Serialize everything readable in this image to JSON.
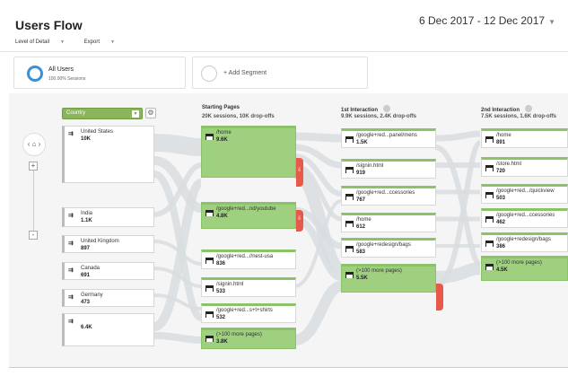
{
  "header": {
    "title": "Users Flow",
    "date_range": "6 Dec 2017 - 12 Dec 2017"
  },
  "toolbar": {
    "level_of_detail": "Level of Detail",
    "export": "Export"
  },
  "segments": {
    "all_users": {
      "title": "All Users",
      "subtitle": "100.00% Sessions"
    },
    "add_segment": "+ Add Segment"
  },
  "dimension_selector": {
    "value": "Country"
  },
  "countries": [
    {
      "name": "United States",
      "count": "10K"
    },
    {
      "name": "India",
      "count": "1.1K"
    },
    {
      "name": "United Kingdom",
      "count": "897"
    },
    {
      "name": "Canada",
      "count": "691"
    },
    {
      "name": "Germany",
      "count": "473"
    },
    {
      "name": "",
      "count": "6.4K"
    }
  ],
  "columns": [
    {
      "title": "Starting Pages",
      "subtitle": "20K sessions, 10K drop-offs",
      "pages": [
        {
          "name": "/home",
          "count": "9.6K"
        },
        {
          "name": "/google+red...nd/youtube",
          "count": "4.8K"
        },
        {
          "name": "/google+red...//nest-usa",
          "count": "836"
        },
        {
          "name": "/signin.html",
          "count": "533"
        },
        {
          "name": "/google+red...s+t+shirts",
          "count": "532"
        },
        {
          "name": "(>100 more pages)",
          "count": "3.8K"
        }
      ]
    },
    {
      "title": "1st Interaction",
      "subtitle": "9.9K sessions, 2.4K drop-offs",
      "pages": [
        {
          "name": "/google+red...panel/mens",
          "count": "1.5K"
        },
        {
          "name": "/signin.html",
          "count": "919"
        },
        {
          "name": "/google+red...ccessories",
          "count": "767"
        },
        {
          "name": "/home",
          "count": "612"
        },
        {
          "name": "/google+redesign/bags",
          "count": "583"
        },
        {
          "name": "(>100 more pages)",
          "count": "5.5K"
        }
      ]
    },
    {
      "title": "2nd Interaction",
      "subtitle": "7.5K sessions, 1.6K drop-offs",
      "pages": [
        {
          "name": "/home",
          "count": "891"
        },
        {
          "name": "/store.html",
          "count": "720"
        },
        {
          "name": "/google+red.../quickview",
          "count": "503"
        },
        {
          "name": "/google+red...ccessories",
          "count": "462"
        },
        {
          "name": "/google+redesign/bags",
          "count": "386"
        },
        {
          "name": "(>100 more pages)",
          "count": "4.5K"
        }
      ]
    }
  ],
  "colors": {
    "accent_green": "#8cc26a",
    "dropoff_red": "#e8594a",
    "segment_ring": "#3b8fd4"
  }
}
